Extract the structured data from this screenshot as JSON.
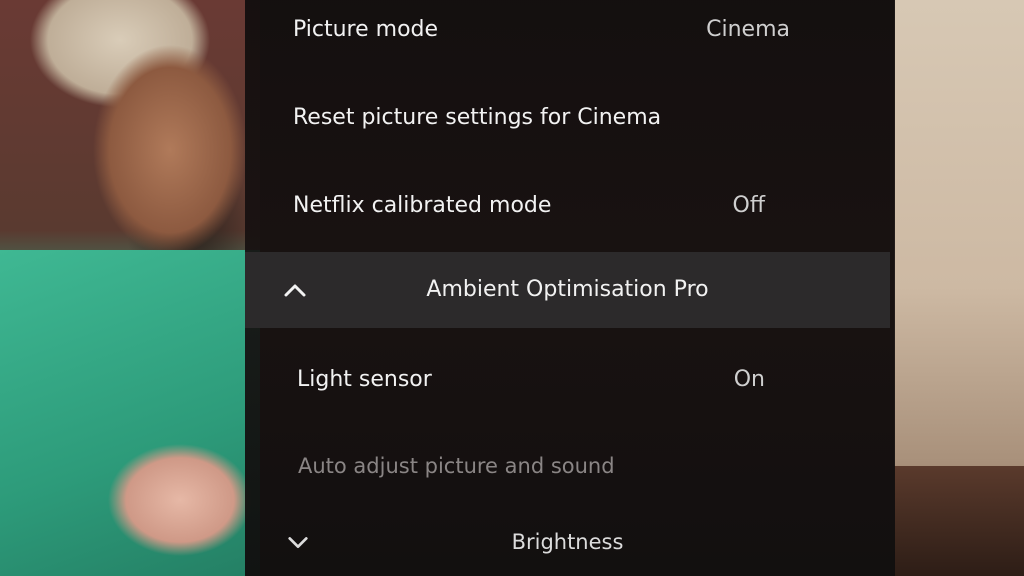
{
  "menu": {
    "items": [
      {
        "label": "Picture mode",
        "value": "Cinema"
      },
      {
        "label": "Reset picture settings for Cinema",
        "value": ""
      },
      {
        "label": "Netflix calibrated mode",
        "value": "Off"
      }
    ],
    "section": {
      "title": "Ambient Optimisation Pro",
      "icon": "chevron-up-icon"
    },
    "sub_items": [
      {
        "label": "Light sensor",
        "value": "On"
      },
      {
        "label": "Auto adjust picture and sound",
        "value": ""
      }
    ],
    "next_section": {
      "title": "Brightness",
      "icon": "chevron-down-icon"
    }
  },
  "colors": {
    "panel_bg": "#151111",
    "section_bg": "#2c2a2b",
    "text": "#f2f2f2",
    "disabled_text": "#8a8585"
  }
}
